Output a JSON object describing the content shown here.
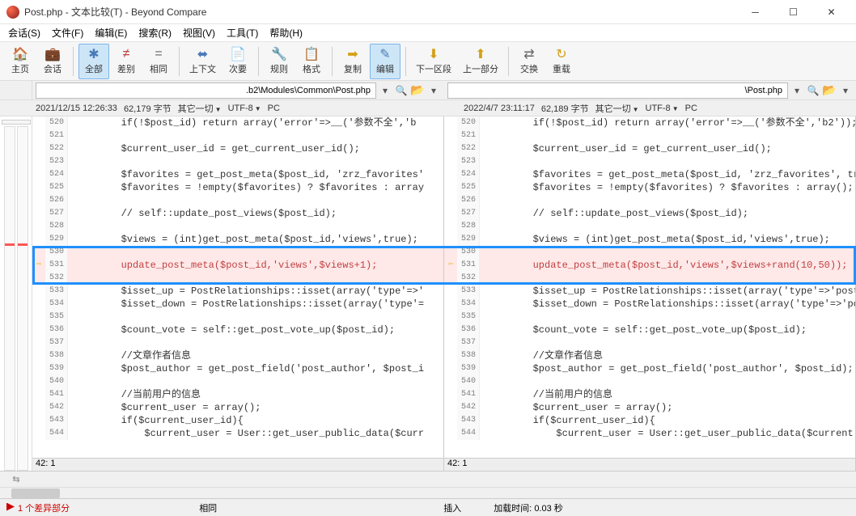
{
  "title": "Post.php - 文本比较(T) - Beyond Compare",
  "menu": [
    "会话(S)",
    "文件(F)",
    "编辑(E)",
    "搜索(R)",
    "视图(V)",
    "工具(T)",
    "帮助(H)"
  ],
  "toolbar": [
    {
      "icon": "🏠",
      "label": "主页",
      "color": "#d4a017"
    },
    {
      "icon": "💼",
      "label": "会话",
      "color": "#b8860b"
    },
    {
      "sep": true
    },
    {
      "icon": "✱",
      "label": "全部",
      "color": "#4a7ab8",
      "active": true
    },
    {
      "icon": "≠",
      "label": "差别",
      "color": "#c04040"
    },
    {
      "icon": "=",
      "label": "相同",
      "color": "#666"
    },
    {
      "sep": true
    },
    {
      "icon": "⬌",
      "label": "上下文",
      "color": "#4a7ab8"
    },
    {
      "icon": "📄",
      "label": "次要",
      "color": "#666"
    },
    {
      "sep": true
    },
    {
      "icon": "🔧",
      "label": "规则",
      "color": "#b8860b"
    },
    {
      "icon": "📋",
      "label": "格式",
      "color": "#666"
    },
    {
      "sep": true
    },
    {
      "icon": "➡",
      "label": "复制",
      "color": "#d4a017"
    },
    {
      "icon": "✎",
      "label": "编辑",
      "color": "#4a7ab8",
      "active": true
    },
    {
      "sep": true
    },
    {
      "icon": "⬇",
      "label": "下一区段",
      "color": "#d4a017"
    },
    {
      "icon": "⬆",
      "label": "上一部分",
      "color": "#d4a017"
    },
    {
      "sep": true
    },
    {
      "icon": "⇄",
      "label": "交换",
      "color": "#666"
    },
    {
      "icon": "↻",
      "label": "重载",
      "color": "#d4a017"
    }
  ],
  "paths": {
    "left": ".b2\\Modules\\Common\\Post.php",
    "right": "\\Post.php"
  },
  "info": {
    "left": {
      "date": "2021/12/15 12:26:33",
      "size": "62,179 字节",
      "misc": "其它一切",
      "enc": "UTF-8",
      "plat": "PC"
    },
    "right": {
      "date": "2022/4/7 23:11:17",
      "size": "62,189 字节",
      "misc": "其它一切",
      "enc": "UTF-8",
      "plat": "PC"
    }
  },
  "code": {
    "start": 520,
    "lines": [
      "        if(!$post_id) return array('error'=>__('参数不全','b",
      "",
      "        $current_user_id = get_current_user_id();",
      "",
      "        $favorites = get_post_meta($post_id, 'zrz_favorites'",
      "        $favorites = !empty($favorites) ? $favorites : array",
      "",
      "        // self::update_post_views($post_id);",
      "",
      "        $views = (int)get_post_meta($post_id,'views',true);",
      "",
      "        update_post_meta($post_id,'views',$views+1);",
      "",
      "        $isset_up = PostRelationships::isset(array('type'=>'",
      "        $isset_down = PostRelationships::isset(array('type'=",
      "",
      "        $count_vote = self::get_post_vote_up($post_id);",
      "",
      "        //文章作者信息",
      "        $post_author = get_post_field('post_author', $post_i",
      "",
      "        //当前用户的信息",
      "        $current_user = array();",
      "        if($current_user_id){",
      "            $current_user = User::get_user_public_data($curr"
    ],
    "lines_right": [
      "        if(!$post_id) return array('error'=>__('参数不全','b2'));",
      "",
      "        $current_user_id = get_current_user_id();",
      "",
      "        $favorites = get_post_meta($post_id, 'zrz_favorites', tr",
      "        $favorites = !empty($favorites) ? $favorites : array();",
      "",
      "        // self::update_post_views($post_id);",
      "",
      "        $views = (int)get_post_meta($post_id,'views',true);",
      "",
      "        update_post_meta($post_id,'views',$views+rand(10,50));",
      "",
      "        $isset_up = PostRelationships::isset(array('type'=>'post",
      "        $isset_down = PostRelationships::isset(array('type'=>'po",
      "",
      "        $count_vote = self::get_post_vote_up($post_id);",
      "",
      "        //文章作者信息",
      "        $post_author = get_post_field('post_author', $post_id);",
      "",
      "        //当前用户的信息",
      "        $current_user = array();",
      "        if($current_user_id){",
      "            $current_user = User::get_user_public_data($current"
    ],
    "diff_index": 11
  },
  "pos": "42: 1",
  "status": {
    "diff": "1 个差异部分",
    "same": "相同",
    "mode": "插入",
    "load": "加载时间:",
    "time": "0.03 秒"
  }
}
